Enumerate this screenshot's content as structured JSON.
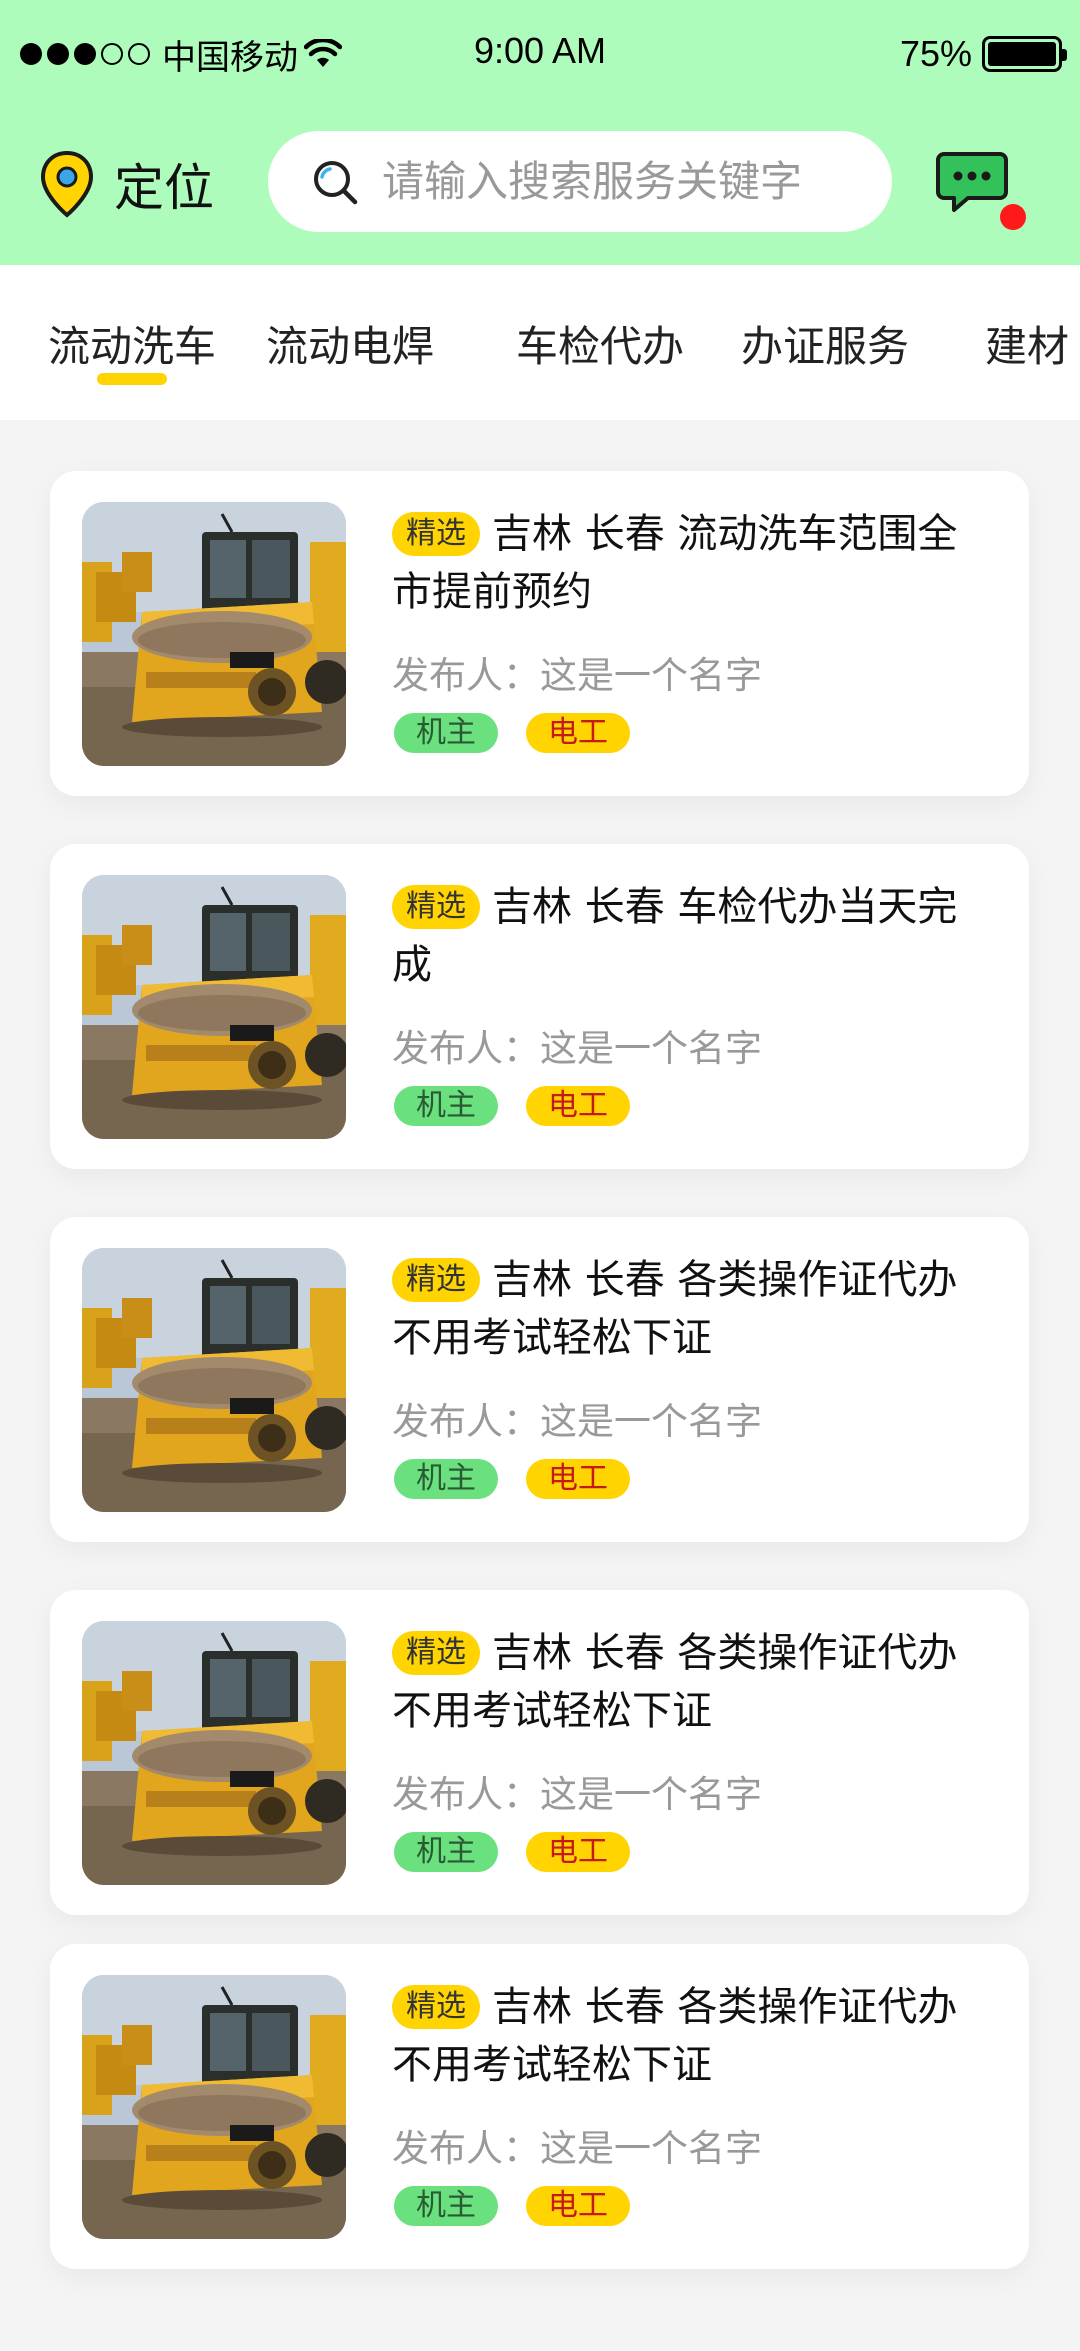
{
  "status_bar": {
    "carrier": "中国移动",
    "time": "9:00 AM",
    "battery": "75%"
  },
  "header": {
    "location_label": "定位",
    "search_placeholder": "请输入搜索服务关键字"
  },
  "tabs": [
    {
      "label": "流动洗车",
      "active": true
    },
    {
      "label": "流动电焊",
      "active": false
    },
    {
      "label": "车检代办",
      "active": false
    },
    {
      "label": "办证服务",
      "active": false
    },
    {
      "label": "建材",
      "active": false
    }
  ],
  "colors": {
    "header_bg": "#aefcbc",
    "accent_yellow": "#ffd400",
    "tag_green": "#6ae07f",
    "notification_red": "#ff1a1a"
  },
  "listings": [
    {
      "badge": "精选",
      "title": "吉林 长春 流动洗车范围全市提前预约",
      "publisher": "发布人：这是一个名字",
      "tags": [
        "机主",
        "电工"
      ],
      "image": "road-roller-photo"
    },
    {
      "badge": "精选",
      "title": "吉林 长春 车检代办当天完成",
      "publisher": "发布人：这是一个名字",
      "tags": [
        "机主",
        "电工"
      ],
      "image": "road-roller-photo"
    },
    {
      "badge": "精选",
      "title": "吉林 长春 各类操作证代办不用考试轻松下证",
      "publisher": "发布人：这是一个名字",
      "tags": [
        "机主",
        "电工"
      ],
      "image": "road-roller-photo"
    },
    {
      "badge": "精选",
      "title": "吉林 长春 各类操作证代办不用考试轻松下证",
      "publisher": "发布人：这是一个名字",
      "tags": [
        "机主",
        "电工"
      ],
      "image": "road-roller-photo"
    },
    {
      "badge": "精选",
      "title": "吉林 长春 各类操作证代办不用考试轻松下证",
      "publisher": "发布人：这是一个名字",
      "tags": [
        "机主",
        "电工"
      ],
      "image": "road-roller-photo"
    }
  ]
}
